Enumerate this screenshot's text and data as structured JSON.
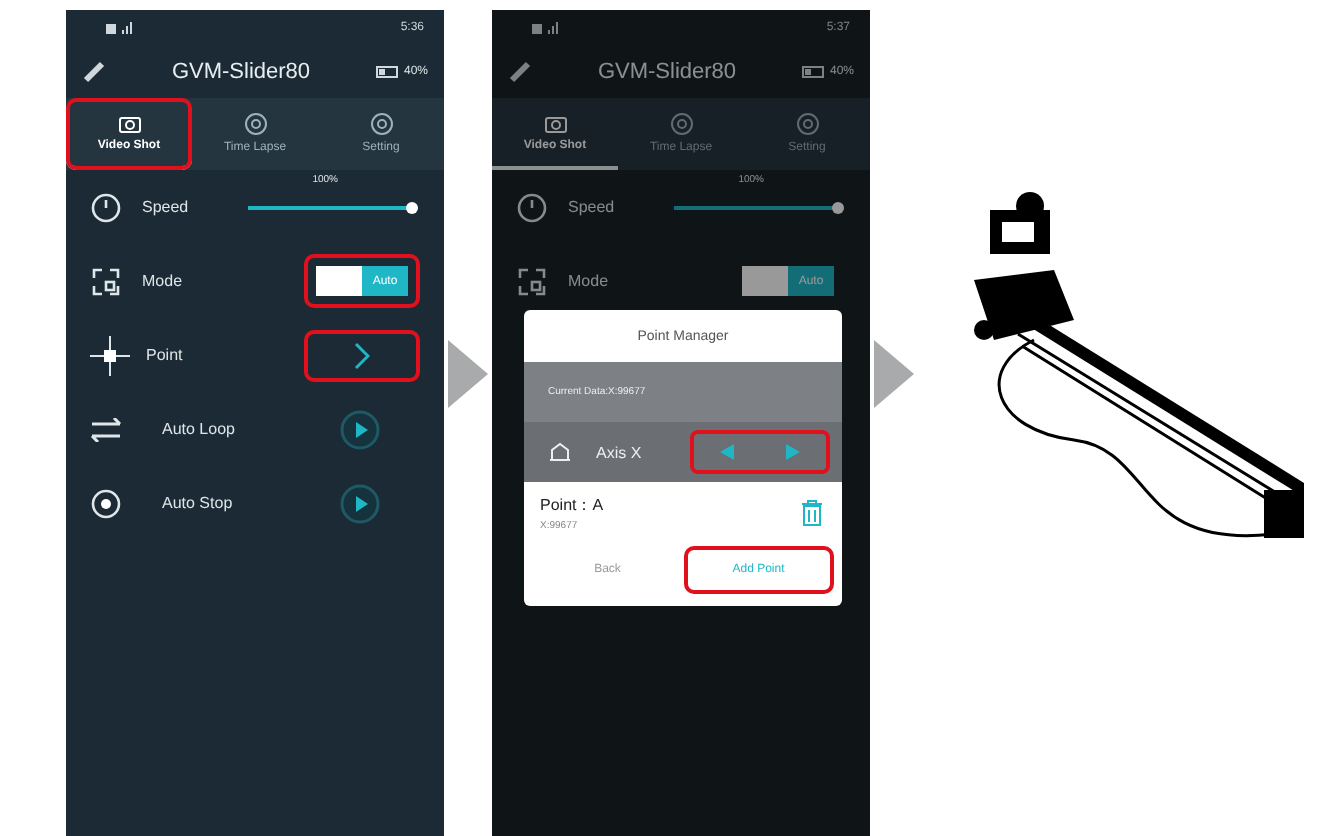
{
  "phones": [
    {
      "dimmed": false,
      "time": "5:36",
      "title": "GVM-Slider80",
      "battery": "40%",
      "tabs": [
        {
          "label": "Video Shot",
          "selected": true,
          "highlighted": true
        },
        {
          "label": "Time Lapse",
          "selected": false,
          "highlighted": false
        },
        {
          "label": "Setting",
          "selected": false,
          "highlighted": false
        }
      ],
      "rows": [
        {
          "kind": "slider",
          "label": "Speed",
          "reading": "100%",
          "level": 1
        },
        {
          "kind": "toggle",
          "label": "Mode",
          "value": "Auto",
          "on": true,
          "highlighted": true
        },
        {
          "kind": "chevron",
          "label": "Point",
          "highlighted": true
        },
        {
          "kind": "play",
          "label": "Auto Loop"
        },
        {
          "kind": "play",
          "label": "Auto Stop"
        }
      ]
    },
    {
      "dimmed": true,
      "time": "5:37",
      "title": "GVM-Slider80",
      "battery": "40%",
      "tabs": [
        {
          "label": "Video Shot",
          "selected": true,
          "highlighted": false
        },
        {
          "label": "Time Lapse",
          "selected": false,
          "highlighted": false
        },
        {
          "label": "Setting",
          "selected": false,
          "highlighted": false
        }
      ],
      "rows": [
        {
          "kind": "slider",
          "label": "Speed",
          "reading": "100%",
          "level": 1
        },
        {
          "kind": "toggle",
          "label": "Mode",
          "value": "Auto",
          "on": true,
          "highlighted": false
        }
      ],
      "dialog": {
        "title": "Point Manager",
        "current": "Current Data:X:99677",
        "axis": "Axis X",
        "arrows_highlighted": true,
        "point": "Point：A",
        "point_value": "X:99677",
        "buttons": [
          {
            "label": "Back",
            "highlighted": false
          },
          {
            "label": "Add Point",
            "highlighted": true
          }
        ]
      }
    }
  ]
}
